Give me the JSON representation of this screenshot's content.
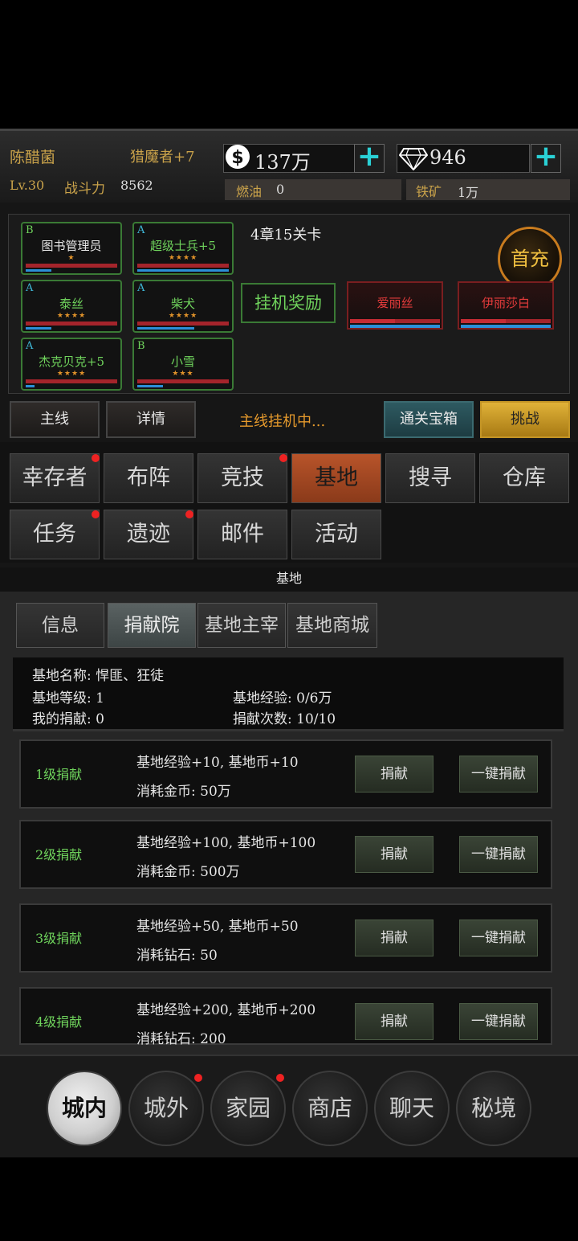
{
  "player": {
    "name": "陈醋菌",
    "title": "猎魔者+7",
    "level": "Lv.30",
    "power_label": "战斗力",
    "power_value": "8562"
  },
  "resources": {
    "gold": "137万",
    "diamond": "946",
    "fuel_label": "燃油",
    "fuel_value": "0",
    "iron_label": "铁矿",
    "iron_value": "1万"
  },
  "team": {
    "members": [
      {
        "grade": "B",
        "name": "图书管理员",
        "stars": "★",
        "mp": 0.28
      },
      {
        "grade": "A",
        "name": "超级士兵+5",
        "stars": "★★★★",
        "mp": 1.0
      },
      {
        "grade": "A",
        "name": "泰丝",
        "stars": "★★★★",
        "mp": 0.28
      },
      {
        "grade": "A",
        "name": "柴犬",
        "stars": "★★★★",
        "mp": 0.62
      },
      {
        "grade": "A",
        "name": "杰克贝克+5",
        "stars": "★★★★",
        "mp": 0.1
      },
      {
        "grade": "B",
        "name": "小雪",
        "stars": "★★★",
        "mp": 0.28
      }
    ],
    "stage": "4章15关卡",
    "idle_reward": "挂机奖励",
    "first_recharge": "首充",
    "enemies": [
      {
        "name": "爱丽丝",
        "hp": 0.5
      },
      {
        "name": "伊丽莎白",
        "hp": 0.5
      }
    ]
  },
  "actions": {
    "mainline": "主线",
    "details": "详情",
    "status": "主线挂机中...",
    "chest": "通关宝箱",
    "challenge": "挑战"
  },
  "menu": [
    {
      "label": "幸存者",
      "dot": true
    },
    {
      "label": "布阵",
      "dot": false
    },
    {
      "label": "竞技",
      "dot": true
    },
    {
      "label": "基地",
      "dot": false,
      "active": true
    },
    {
      "label": "搜寻",
      "dot": false
    },
    {
      "label": "仓库",
      "dot": false
    },
    {
      "label": "任务",
      "dot": true
    },
    {
      "label": "遗迹",
      "dot": true
    },
    {
      "label": "邮件",
      "dot": false
    },
    {
      "label": "活动",
      "dot": false
    }
  ],
  "section_title": "基地",
  "tabs": [
    "信息",
    "捐献院",
    "基地主宰",
    "基地商城"
  ],
  "base_info": {
    "name": "基地名称: 悍匪、狂徒",
    "level": "基地等级: 1",
    "exp": "基地经验: 0/6万",
    "my_donation": "我的捐献: 0",
    "donation_count": "捐献次数: 10/10"
  },
  "donations": [
    {
      "level": "1级捐献",
      "reward": "基地经验+10, 基地币+10",
      "cost": "消耗金币: 50万",
      "btn": "捐献",
      "btn_all": "一键捐献"
    },
    {
      "level": "2级捐献",
      "reward": "基地经验+100, 基地币+100",
      "cost": "消耗金币: 500万",
      "btn": "捐献",
      "btn_all": "一键捐献"
    },
    {
      "level": "3级捐献",
      "reward": "基地经验+50, 基地币+50",
      "cost": "消耗钻石: 50",
      "btn": "捐献",
      "btn_all": "一键捐献"
    },
    {
      "level": "4级捐献",
      "reward": "基地经验+200, 基地币+200",
      "cost": "消耗钻石: 200",
      "btn": "捐献",
      "btn_all": "一键捐献"
    }
  ],
  "bottom_nav": [
    {
      "label": "城内",
      "dot": false,
      "active": true
    },
    {
      "label": "城外",
      "dot": true
    },
    {
      "label": "家园",
      "dot": true
    },
    {
      "label": "商店",
      "dot": false
    },
    {
      "label": "聊天",
      "dot": false
    },
    {
      "label": "秘境",
      "dot": false
    }
  ]
}
